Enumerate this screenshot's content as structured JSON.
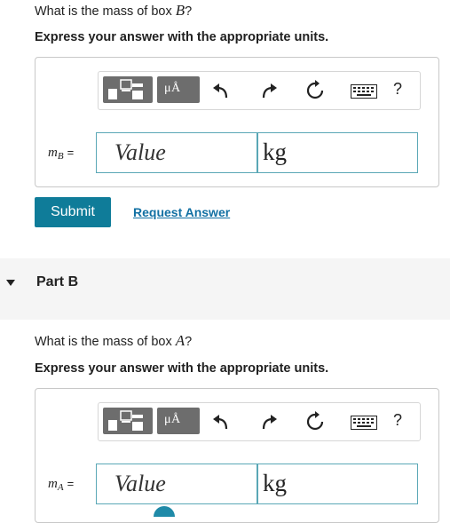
{
  "partA": {
    "question_prefix": "What is the mass of box ",
    "question_var": "B",
    "question_suffix": "?",
    "instruction": "Express your answer with the appropriate units.",
    "answer_label_base": "m",
    "answer_label_sub": "B",
    "answer_label_eq": "=",
    "value_placeholder": "Value",
    "unit_value": "kg"
  },
  "toolbar": {
    "units_glyph": "μÅ",
    "help_glyph": "?"
  },
  "actions": {
    "submit_label": "Submit",
    "request_label": "Request Answer"
  },
  "partB": {
    "title": "Part B",
    "question_prefix": "What is the mass of box ",
    "question_var": "A",
    "question_suffix": "?",
    "instruction": "Express your answer with the appropriate units.",
    "answer_label_base": "m",
    "answer_label_sub": "A",
    "answer_label_eq": "=",
    "value_placeholder": "Value",
    "unit_value": "kg"
  },
  "colors": {
    "accent": "#0f7c99",
    "link": "#1270a3",
    "input_border": "#5aa7b6",
    "toolbar_button": "#6d6d6d"
  }
}
